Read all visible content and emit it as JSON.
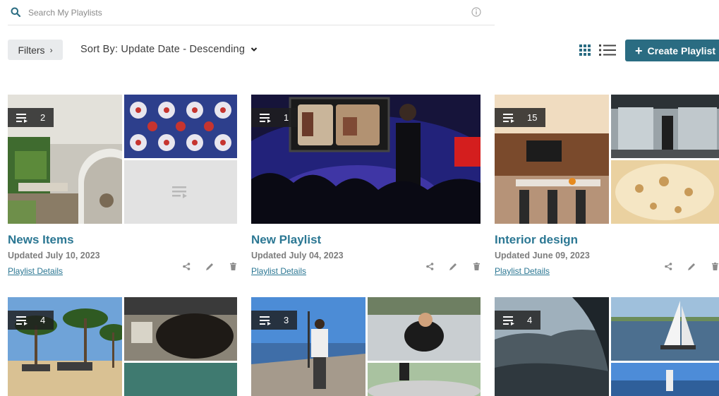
{
  "search": {
    "placeholder": "Search My Playlists",
    "icon": "search-icon",
    "info_icon": "info-icon"
  },
  "toolbar": {
    "filters_label": "Filters",
    "sort_label": "Sort By: Update Date - Descending",
    "create_label": "Create Playlist",
    "accent_color": "#2a6c82"
  },
  "playlists": [
    {
      "title": "News Items",
      "updated": "Updated July 10, 2023",
      "details_label": "Playlist Details",
      "count": "2"
    },
    {
      "title": "New Playlist",
      "updated": "Updated July 04, 2023",
      "details_label": "Playlist Details",
      "count": "1"
    },
    {
      "title": "Interior design",
      "updated": "Updated June 09, 2023",
      "details_label": "Playlist Details",
      "count": "15"
    },
    {
      "title": "",
      "updated": "",
      "details_label": "",
      "count": "4"
    },
    {
      "title": "",
      "updated": "",
      "details_label": "",
      "count": "3"
    },
    {
      "title": "",
      "updated": "",
      "details_label": "",
      "count": "4"
    }
  ]
}
